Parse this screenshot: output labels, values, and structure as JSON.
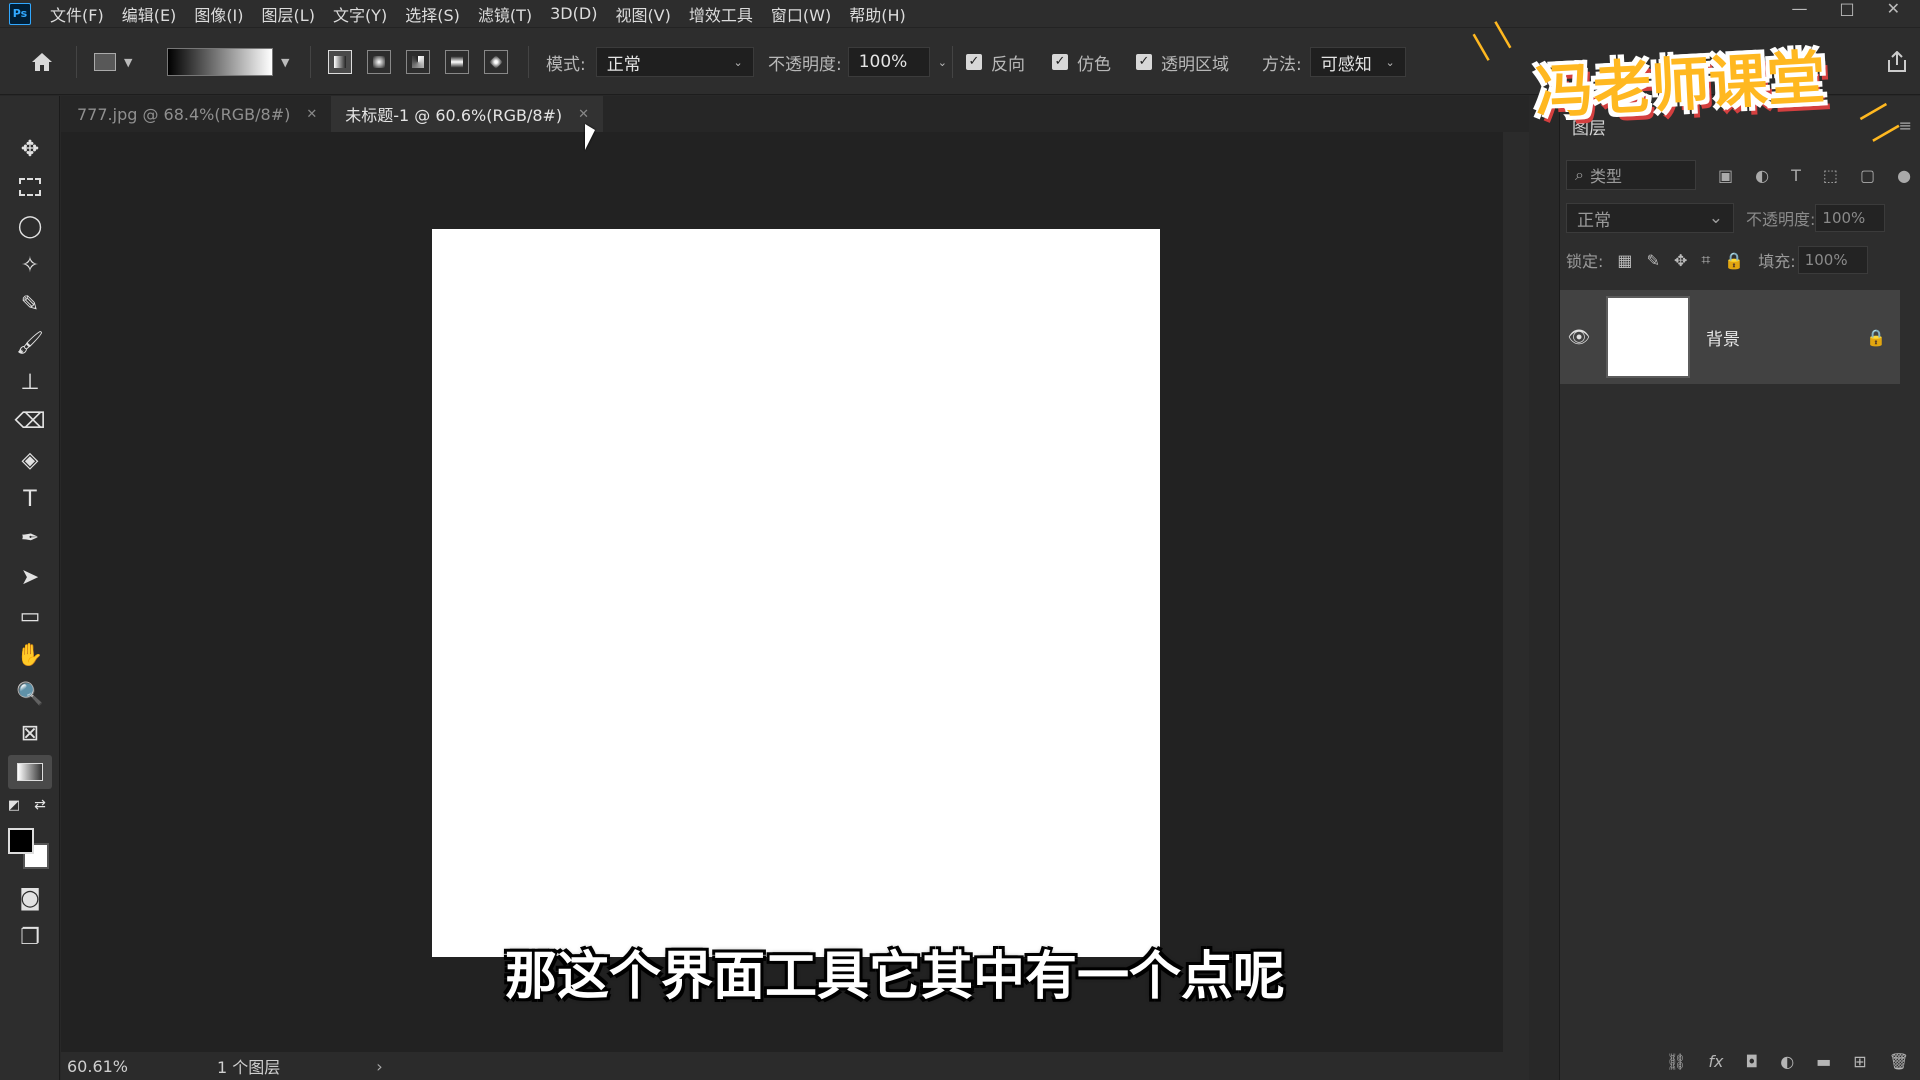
{
  "app": {
    "logo_text": "Ps"
  },
  "menu": [
    "文件(F)",
    "编辑(E)",
    "图像(I)",
    "图层(L)",
    "文字(Y)",
    "选择(S)",
    "滤镜(T)",
    "3D(D)",
    "视图(V)",
    "增效工具",
    "窗口(W)",
    "帮助(H)"
  ],
  "window_controls": {
    "minimize": "—",
    "maximize": "□",
    "close": "✕"
  },
  "options": {
    "mode_label": "模式:",
    "mode_value": "正常",
    "opacity_label": "不透明度:",
    "opacity_value": "100%",
    "reverse_label": "反向",
    "dither_label": "仿色",
    "transparency_label": "透明区域",
    "method_label": "方法:",
    "method_value": "可感知",
    "gradient_colors": [
      "#000000",
      "#ffffff"
    ],
    "reverse_checked": true,
    "dither_checked": true,
    "transparency_checked": true
  },
  "tabs": [
    {
      "label": "777.jpg @ 68.4%(RGB/8#)",
      "active": false
    },
    {
      "label": "未标题-1 @ 60.6%(RGB/8#)",
      "active": true
    }
  ],
  "status": {
    "zoom": "60.61%",
    "layers": "1 个图层"
  },
  "colors": {
    "foreground": "#000000",
    "background": "#ffffff",
    "accent": "#31a8ff"
  },
  "layers_panel": {
    "tab_label": "图层",
    "filter_placeholder": "类型",
    "blend_mode": "正常",
    "opacity_label": "不透明度:",
    "opacity_value": "100%",
    "lock_label": "锁定:",
    "fill_label": "填充:",
    "fill_value": "100%",
    "layers": [
      {
        "name": "背景",
        "visible": true,
        "locked": true
      }
    ]
  },
  "overlay": {
    "watermark": "冯老师课堂",
    "subtitle": "那这个界面工具它其中有一个点呢"
  }
}
